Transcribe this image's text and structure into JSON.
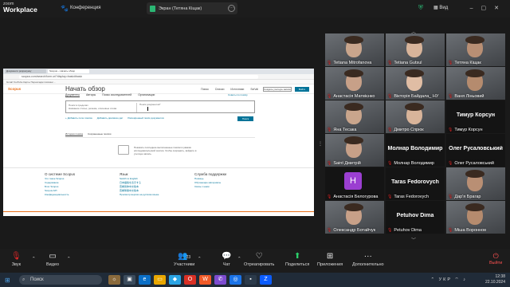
{
  "app": {
    "brand_top": "zoom",
    "brand_bottom": "Workplace",
    "conference_label": "Конференция"
  },
  "share": {
    "label": "Экран (Тетяна Кіщак)"
  },
  "view_label": "Вид",
  "browser": {
    "tabs": [
      "Документи розрахунку",
      "Scopus – Начать обзор"
    ],
    "url": "scopus.com/search/form.uri?display=basic#basic",
    "bookmarks": "Gmail   YouTube   Карты   Перекладач   Новини   ..."
  },
  "scopus": {
    "logo": "Scopus",
    "nav": [
      "Поиск",
      "Списки",
      "Источники",
      "SciVal"
    ],
    "create_account": "Создать учетную запись",
    "login": "Войти",
    "title": "Начать обзор",
    "tabs": [
      "Документы",
      "Авторы",
      "Поиск исследователей",
      "Организации"
    ],
    "tips": "Советы по поиску",
    "field_label": "Поиск в пределах",
    "field_value": "Название статьи, резюме, ключевые слова",
    "doc_label": "Поиск документов*",
    "add_field": "+ Добавить поле поиска",
    "add_range": "Добавить диапазон дат",
    "advanced": "Расширенный поиск документов",
    "search_button": "Поиск",
    "hist_tabs": [
      "История поиска",
      "Сохраненные поиски"
    ],
    "hist_text": "Показать последние выполненные поиски в рамках исследовательской сессии. Чтобы сохранить, войдите в учетную запись.",
    "footer": [
      {
        "heading": "О системе Scopus",
        "links": [
          "Что такое Scopus",
          "Содержание",
          "Блог Scopus",
          "Scopus API",
          "Конфиденциальность"
        ]
      },
      {
        "heading": "Язык",
        "links": [
          "Switch to English",
          "日本語版を表示する",
          "查看简体中文版本",
          "查看繁體中文版本",
          "Просмотр версии на русском языке"
        ]
      },
      {
        "heading": "Служба поддержки",
        "links": [
          "Помощь",
          "Обучающие материалы",
          "Связь с нами"
        ]
      }
    ]
  },
  "participants": [
    {
      "name": "Tetiana Mitrofanova",
      "video": true
    },
    {
      "name": "Tetiana Gutsul",
      "video": true
    },
    {
      "name": "Тетяна Кіщак",
      "video": true,
      "active": true
    },
    {
      "name": "Анастасія Матвієнко",
      "video": true
    },
    {
      "name": "Вікторія Байдала_ НУ",
      "video": true
    },
    {
      "name": "Ваня Ліньовий",
      "video": true
    },
    {
      "name": "Яна Тесака",
      "video": true
    },
    {
      "name": "Дмитро Спрюк",
      "video": true
    },
    {
      "name": "Тимур Корсун",
      "video": false,
      "big": "Тимур Корсун"
    },
    {
      "name": "Saint Дмитрій",
      "video": true
    },
    {
      "name": "Молнар Володимир",
      "video": false,
      "big": "Молнар Володимир"
    },
    {
      "name": "Олег Русаловський",
      "video": false,
      "big": "Олег Русаловський"
    },
    {
      "name": "Анастасія Белогурова",
      "video": false,
      "avatar": "H"
    },
    {
      "name": "Taras Fedorovych",
      "video": false,
      "big": "Taras Fedorovych"
    },
    {
      "name": "Дар'я Брагар",
      "video": true
    },
    {
      "name": "Олександр Ботайчук",
      "video": true
    },
    {
      "name": "Petuhov Dima",
      "video": false,
      "big": "Petuhov Dima"
    },
    {
      "name": "Міша Вороннов",
      "video": true
    }
  ],
  "toolbar": {
    "audio": "Звук",
    "video": "Видео",
    "participants": "Участники",
    "participants_count": "23",
    "chat": "Чат",
    "react": "Отреагировать",
    "share": "Поделиться",
    "apps": "Приложения",
    "more": "Дополнительно",
    "leave": "Выйти"
  },
  "taskbar": {
    "search_placeholder": "Поиск",
    "language": "УКР",
    "time": "12:38",
    "date": "22.10.2024"
  }
}
